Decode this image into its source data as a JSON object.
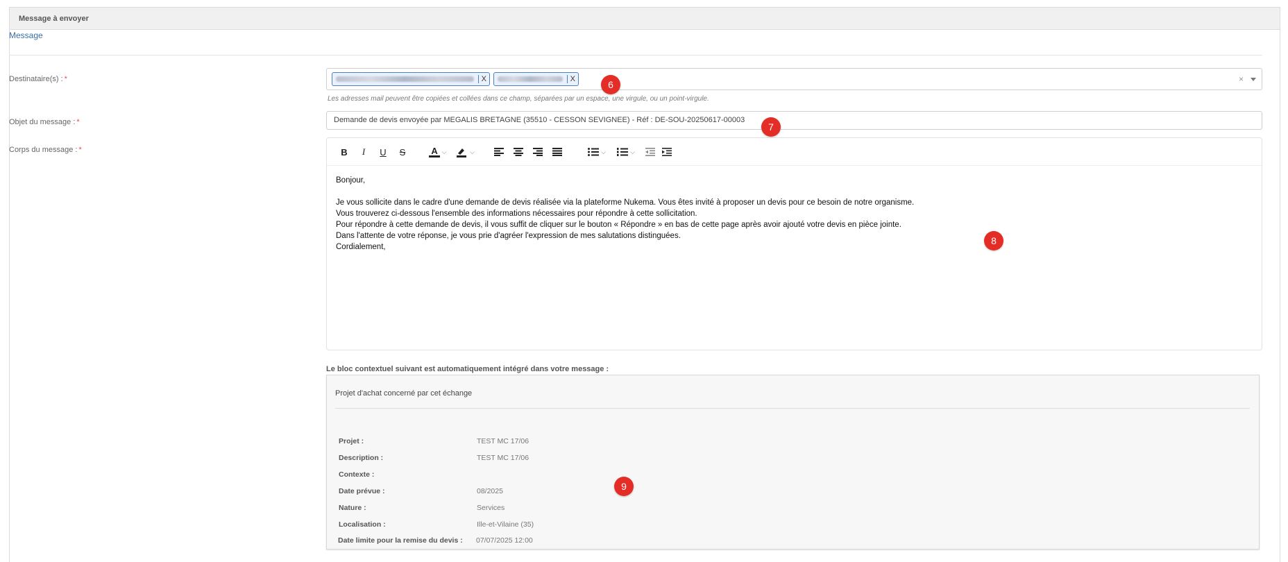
{
  "panel": {
    "title": "Message à envoyer"
  },
  "section": {
    "tab_label": "Message"
  },
  "recipients": {
    "label": "Destinataire(s) :",
    "required_mark": "*",
    "hint": "Les adresses mail peuvent être copiées et collées dans ce champ, séparées par un espace, une virgule, ou un point-virgule.",
    "tags": [
      {
        "remove_label": "X"
      },
      {
        "remove_label": "X"
      }
    ],
    "clear_glyph": "×"
  },
  "subject": {
    "label": "Objet du message :",
    "required_mark": "*",
    "value": "Demande de devis envoyée par MEGALIS BRETAGNE (35510 - CESSON SEVIGNEE) - Réf : DE-SOU-20250617-00003"
  },
  "body": {
    "label": "Corps du message :",
    "required_mark": "*",
    "toolbar": {
      "bold": "B",
      "italic": "I",
      "underline": "U",
      "strike": "S",
      "font_color": "A",
      "chevron": "⌵"
    },
    "greeting": "Bonjour,",
    "lines": [
      "Je vous sollicite dans le cadre d'une demande de devis réalisée via la plateforme Nukema. Vous êtes invité à proposer un devis pour ce besoin de notre organisme.",
      "Vous trouverez ci-dessous l'ensemble des informations nécessaires pour répondre à cette sollicitation.",
      "Pour répondre à cette demande de devis, il vous suffit de cliquer sur le bouton « Répondre » en bas de cette page après avoir ajouté votre devis en pièce jointe.",
      "Dans l'attente de votre réponse, je vous prie d'agréer l'expression de mes salutations distinguées.",
      "Cordialement,"
    ]
  },
  "context": {
    "title": "Le bloc contextuel suivant est automatiquement intégré dans votre message :",
    "heading": "Projet d'achat concerné par cet échange",
    "rows": [
      {
        "key": "Projet :",
        "value": "TEST MC 17/06"
      },
      {
        "key": "Description :",
        "value": "TEST MC 17/06"
      },
      {
        "key": "Contexte :",
        "value": ""
      },
      {
        "key": "Date prévue :",
        "value": "08/2025"
      },
      {
        "key": "Nature :",
        "value": "Services"
      },
      {
        "key": "Localisation :",
        "value": "Ille-et-Vilaine (35)"
      },
      {
        "key": "Date limite pour la remise du devis :",
        "value": "07/07/2025 12:00"
      }
    ]
  },
  "annotations": [
    "6",
    "7",
    "8",
    "9"
  ],
  "colors": {
    "accent": "#3a6ea5",
    "required": "#d9534f",
    "badge": "#e52d27",
    "tag_border": "#4a7fc1"
  }
}
